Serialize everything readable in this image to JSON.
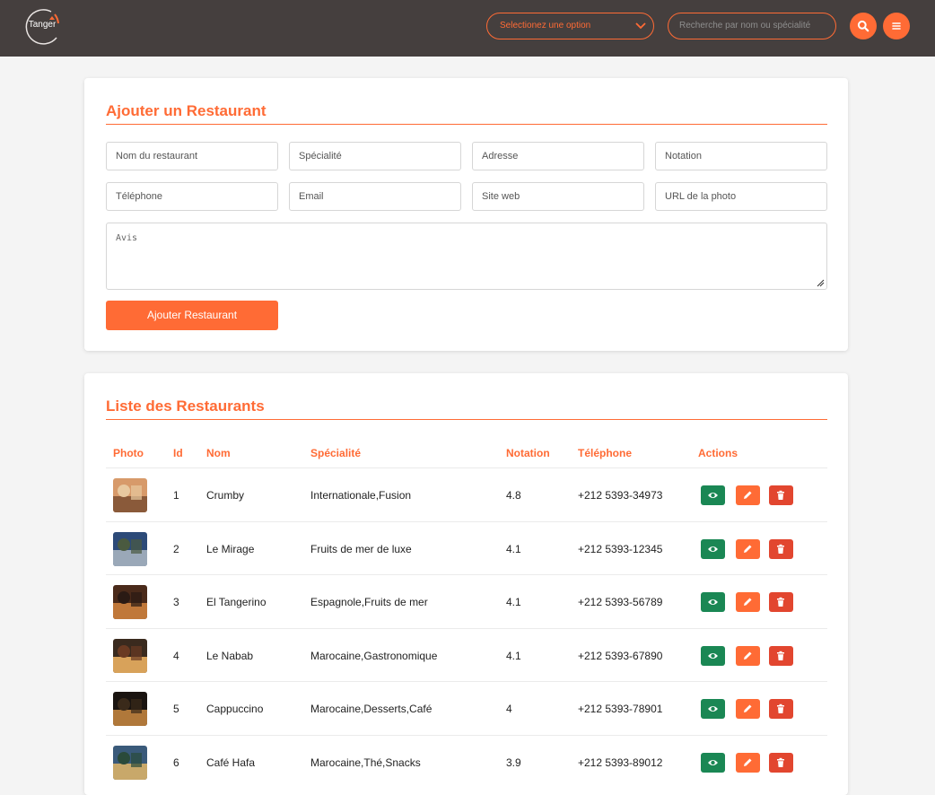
{
  "header": {
    "logo_text": "Tanger",
    "select_placeholder": "Selectionez une option",
    "search_placeholder": "Recherche par nom ou spécialité"
  },
  "form": {
    "title": "Ajouter un Restaurant",
    "fields": [
      "Nom du restaurant",
      "Spécialité",
      "Adresse",
      "Notation",
      "Téléphone",
      "Email",
      "Site web",
      "URL de la photo"
    ],
    "avis_placeholder": "Avis",
    "submit_label": "Ajouter Restaurant"
  },
  "list": {
    "title": "Liste des Restaurants",
    "columns": [
      "Photo",
      "Id",
      "Nom",
      "Spécialité",
      "Notation",
      "Téléphone",
      "Actions"
    ],
    "rows": [
      {
        "id": "1",
        "nom": "Crumby",
        "specialite": "Internationale,Fusion",
        "notation": "4.8",
        "telephone": "+212 5393-34973"
      },
      {
        "id": "2",
        "nom": "Le Mirage",
        "specialite": "Fruits de mer de luxe",
        "notation": "4.1",
        "telephone": "+212 5393-12345"
      },
      {
        "id": "3",
        "nom": "El Tangerino",
        "specialite": "Espagnole,Fruits de mer",
        "notation": "4.1",
        "telephone": "+212 5393-56789"
      },
      {
        "id": "4",
        "nom": "Le Nabab",
        "specialite": "Marocaine,Gastronomique",
        "notation": "4.1",
        "telephone": "+212 5393-67890"
      },
      {
        "id": "5",
        "nom": "Cappuccino",
        "specialite": "Marocaine,Desserts,Café",
        "notation": "4",
        "telephone": "+212 5393-78901"
      },
      {
        "id": "6",
        "nom": "Café Hafa",
        "specialite": "Marocaine,Thé,Snacks",
        "notation": "3.9",
        "telephone": "+212 5393-89012"
      }
    ]
  },
  "colors": {
    "accent": "#ff6b35",
    "header_bg": "#453f3e",
    "view": "#1a8754",
    "delete": "#e2462f"
  }
}
